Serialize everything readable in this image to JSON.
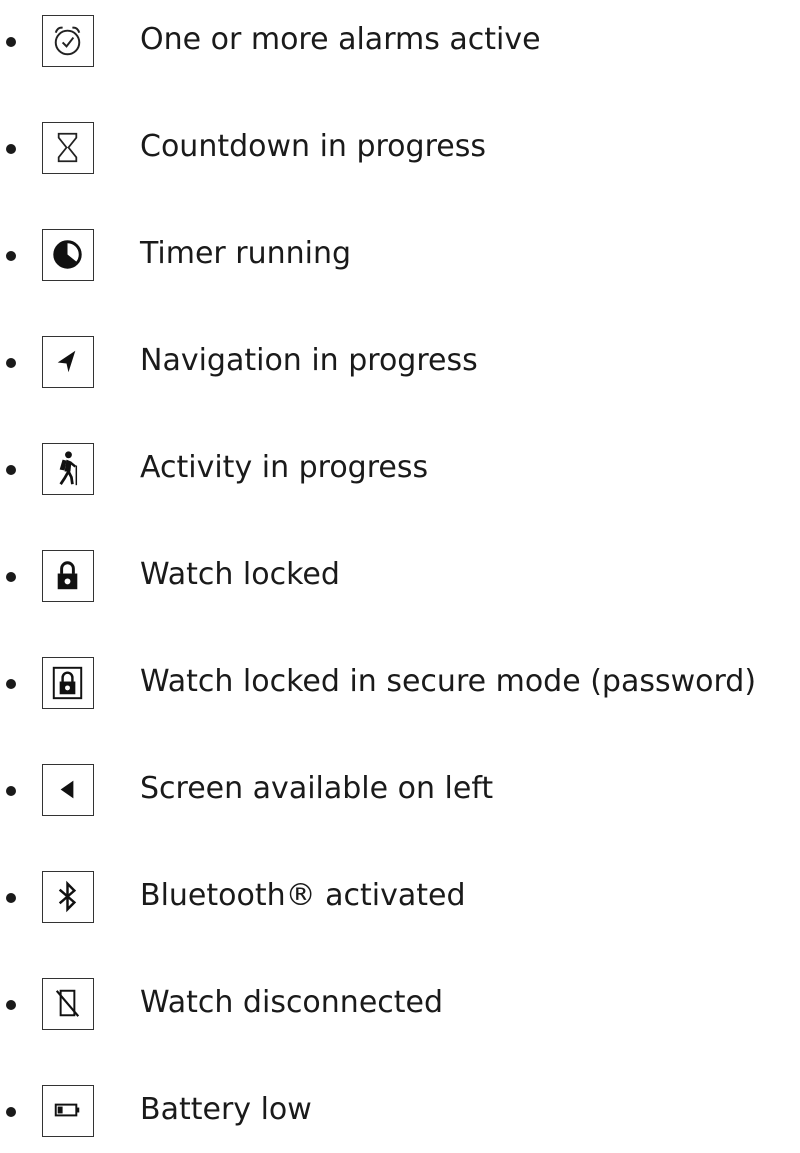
{
  "status_icons": {
    "items": [
      {
        "icon": "alarm-clock-icon",
        "label": "One or more alarms active"
      },
      {
        "icon": "hourglass-icon",
        "label": "Countdown in progress"
      },
      {
        "icon": "timer-icon",
        "label": "Timer running"
      },
      {
        "icon": "navigation-arrow-icon",
        "label": "Navigation in progress"
      },
      {
        "icon": "hiker-icon",
        "label": "Activity in progress"
      },
      {
        "icon": "lock-icon",
        "label": "Watch locked"
      },
      {
        "icon": "secure-lock-icon",
        "label": "Watch locked in secure mode (password)"
      },
      {
        "icon": "left-arrow-icon",
        "label": "Screen available on left"
      },
      {
        "icon": "bluetooth-icon",
        "label": "Bluetooth® activated"
      },
      {
        "icon": "phone-disconnected-icon",
        "label": "Watch disconnected"
      },
      {
        "icon": "battery-low-icon",
        "label": "Battery low"
      }
    ]
  }
}
